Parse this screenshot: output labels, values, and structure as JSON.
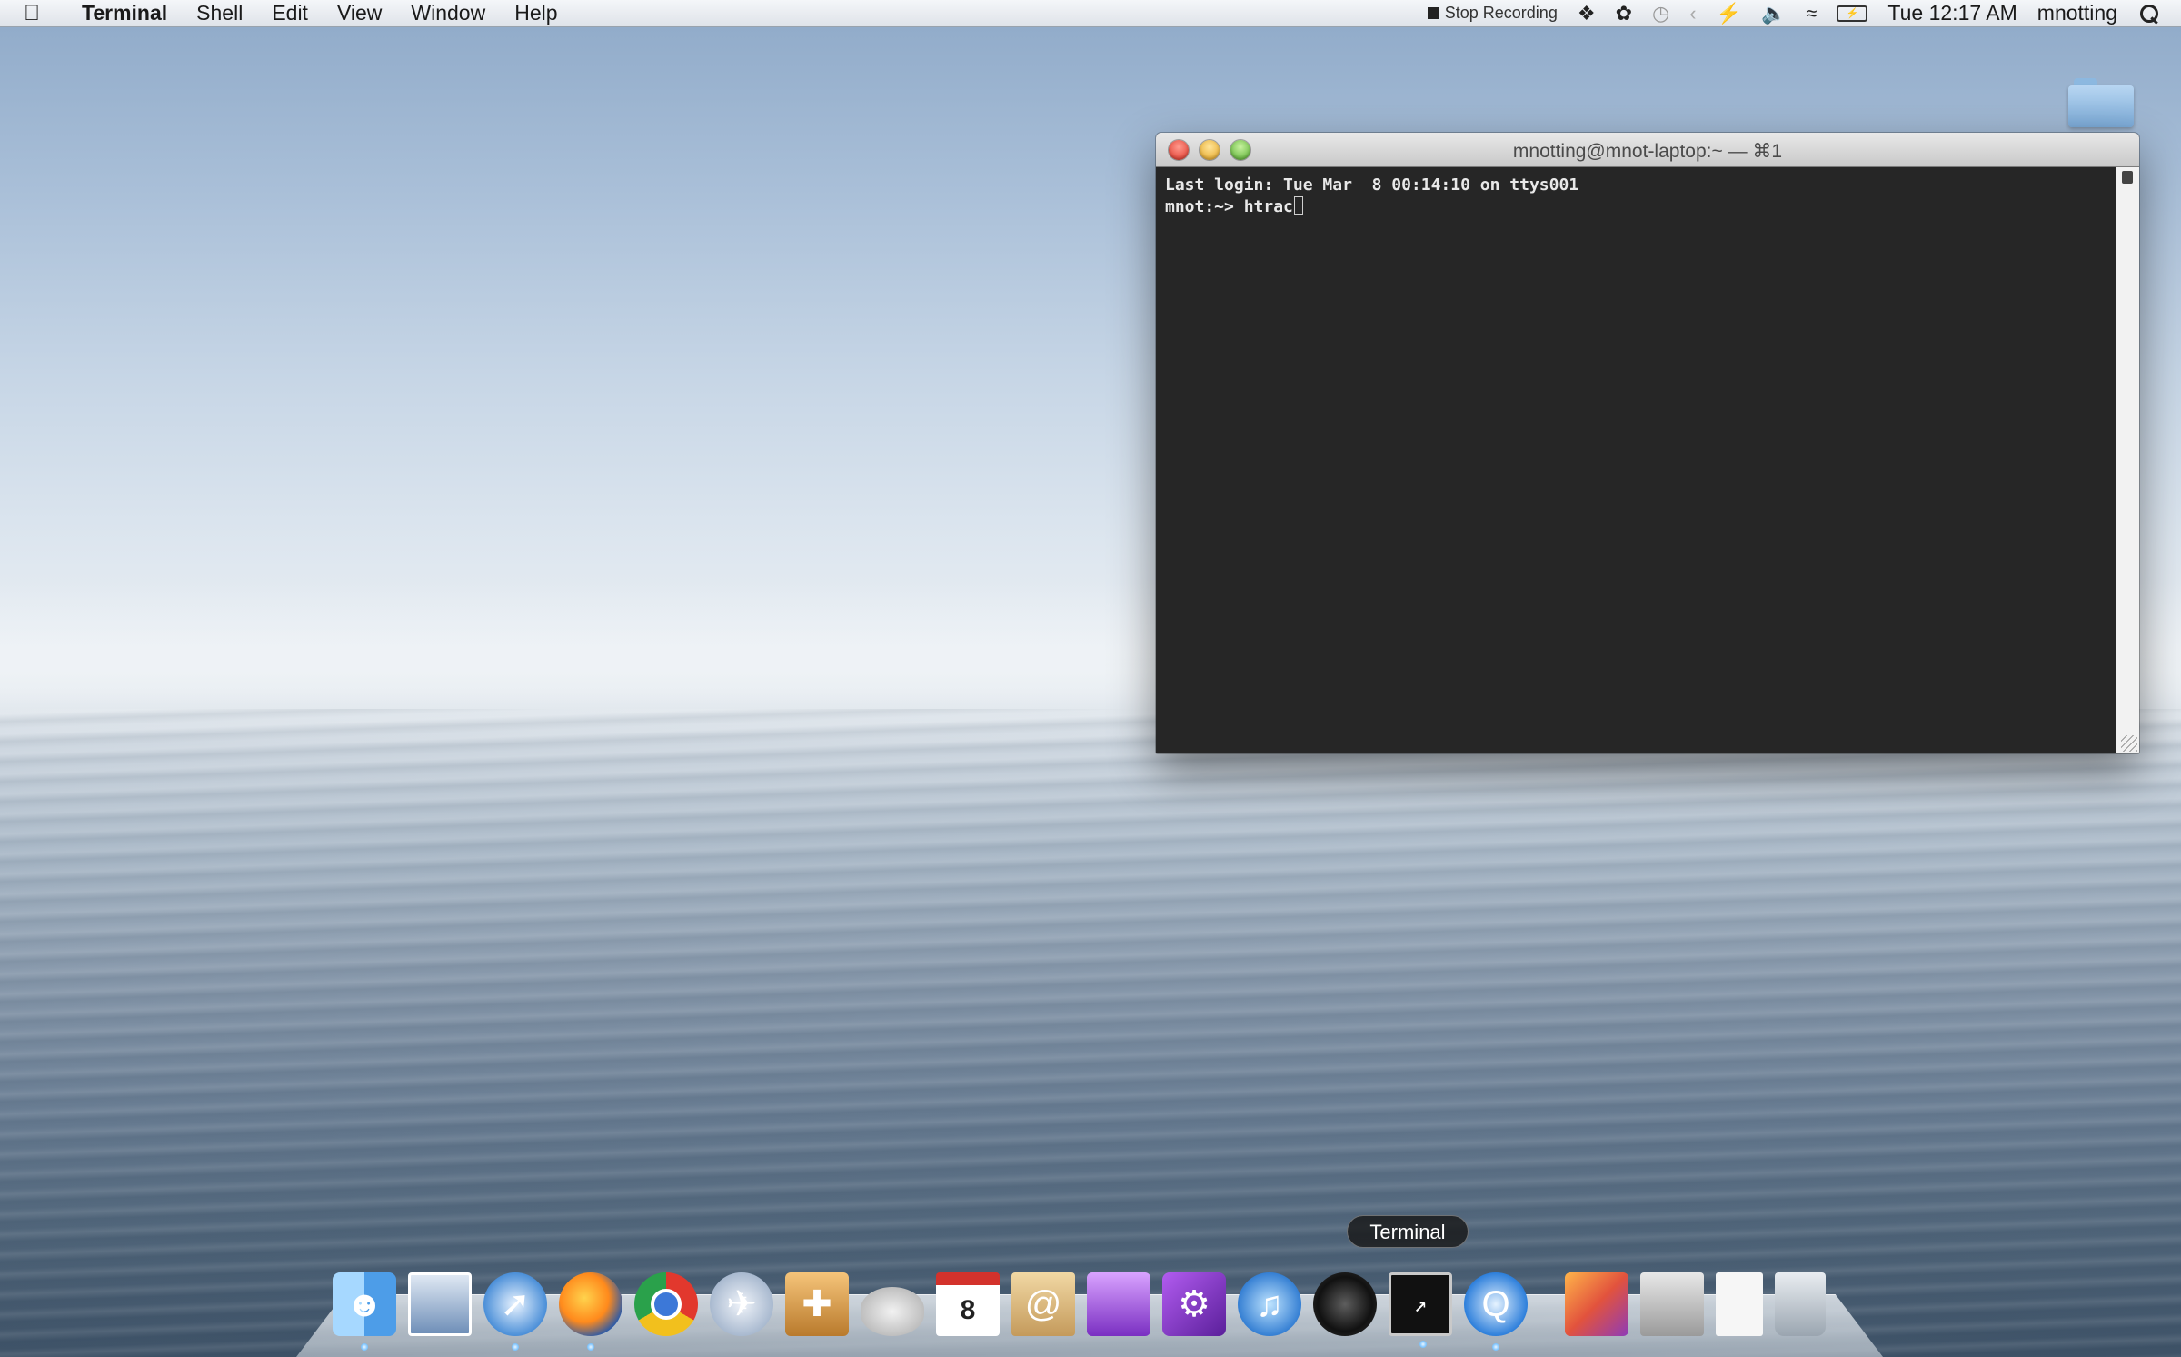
{
  "menubar": {
    "apple_icon": "apple-icon",
    "app_name": "Terminal",
    "menus": [
      "Shell",
      "Edit",
      "View",
      "Window",
      "Help"
    ],
    "stop_recording": "Stop Recording",
    "clock": "Tue 12:17 AM",
    "user": "mnotting",
    "status_icons": [
      "dropbox-icon",
      "growl-icon",
      "timemachine-icon",
      "bluetooth-icon",
      "power-icon",
      "volume-icon",
      "wifi-icon",
      "battery-icon",
      "spotlight-icon"
    ]
  },
  "desktop": {
    "folder_icon": "folder-icon"
  },
  "terminal": {
    "title": "mnotting@mnot-laptop:~ — ⌘1",
    "lines": [
      "Last login: Tue Mar  8 00:14:10 on ttys001",
      "mnot:~> htrac"
    ]
  },
  "dock": {
    "tooltip": "Terminal",
    "apps": [
      {
        "name": "finder-icon",
        "running": true
      },
      {
        "name": "preview-icon",
        "running": false
      },
      {
        "name": "safari-icon",
        "running": true
      },
      {
        "name": "firefox-icon",
        "running": true
      },
      {
        "name": "chrome-icon",
        "running": false
      },
      {
        "name": "mail-icon",
        "running": false
      },
      {
        "name": "package-icon",
        "running": false
      },
      {
        "name": "chat-icon",
        "running": false
      },
      {
        "name": "calendar-icon",
        "running": false,
        "label": "8"
      },
      {
        "name": "address-book-icon",
        "running": false
      },
      {
        "name": "folder-app-icon",
        "running": false
      },
      {
        "name": "app-icon",
        "running": false
      },
      {
        "name": "itunes-icon",
        "running": false
      },
      {
        "name": "camera-icon",
        "running": false
      },
      {
        "name": "terminal-icon",
        "running": true
      },
      {
        "name": "quicktime-icon",
        "running": true
      },
      {
        "name": "media-icon",
        "running": false
      },
      {
        "name": "screen-icon",
        "running": false
      },
      {
        "name": "document-icon",
        "running": false
      },
      {
        "name": "trash-icon",
        "running": false
      }
    ]
  }
}
